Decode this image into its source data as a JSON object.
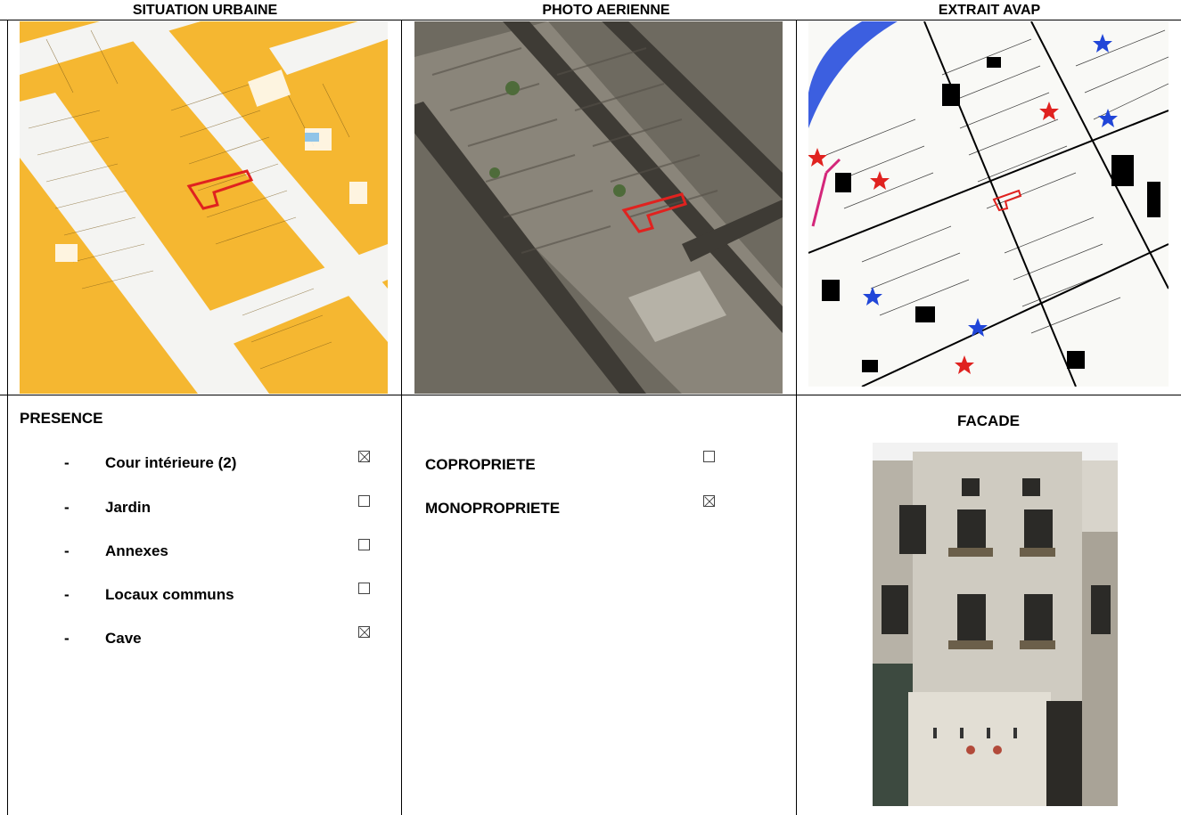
{
  "headers": {
    "col1": "SITUATION URBAINE",
    "col2": "PHOTO AERIENNE",
    "col3": "EXTRAIT AVAP"
  },
  "presence": {
    "title": "PRESENCE",
    "items": [
      {
        "dash": "-",
        "label": "Cour intérieure (2)",
        "checked": true
      },
      {
        "dash": "-",
        "label": "Jardin",
        "checked": false
      },
      {
        "dash": "-",
        "label": "Annexes",
        "checked": false
      },
      {
        "dash": "-",
        "label": "Locaux communs",
        "checked": false
      },
      {
        "dash": "-",
        "label": "Cave",
        "checked": true
      }
    ]
  },
  "ownership": {
    "items": [
      {
        "label": "COPROPRIETE",
        "checked": false
      },
      {
        "label": "MONOPROPRIETE",
        "checked": true
      }
    ]
  },
  "facade": {
    "title": "FACADE"
  },
  "colors": {
    "plan_fill": "#f5b731",
    "street": "#f4f4f2",
    "highlight": "#e0221f",
    "star_red": "#e0221f",
    "star_blue": "#2146d8"
  }
}
